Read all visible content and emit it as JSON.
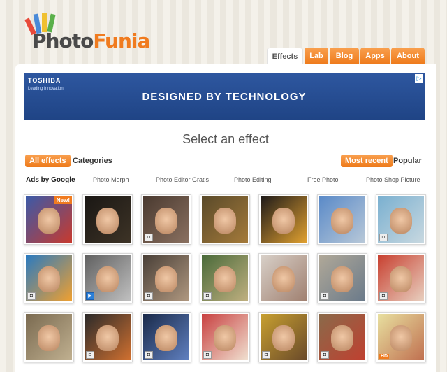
{
  "logo": {
    "part1": "Photo",
    "part2": "Funia"
  },
  "nav": {
    "tabs": [
      {
        "label": "Effects",
        "active": true
      },
      {
        "label": "Lab",
        "active": false
      },
      {
        "label": "Blog",
        "active": false
      },
      {
        "label": "Apps",
        "active": false
      },
      {
        "label": "About",
        "active": false
      }
    ]
  },
  "ad": {
    "brand": "TOSHIBA",
    "tagline": "Leading Innovation",
    "slogan": "DESIGNED BY TECHNOLOGY",
    "adchoice_icon": "adchoices-icon"
  },
  "heading": "Select an effect",
  "filters": {
    "all_effects": "All effects",
    "categories": "Categories",
    "most_recent": "Most recent",
    "popular": "Popular"
  },
  "ads_row": {
    "label": "Ads by Google",
    "links": [
      "Photo Morph",
      "Photo Editor Gratis",
      "Photo Editing",
      "Free Photo",
      "Photo Shop Picture"
    ]
  },
  "badges": {
    "new": "New!",
    "hd": "HD",
    "photo_icon": "photo-icon",
    "video_icon": "video-icon"
  },
  "colors": {
    "accent": "#ee7a1a",
    "ad_blue": "#1f4485"
  },
  "effects": [
    {
      "name": "times-square-billboard",
      "colors": [
        "#3b5aa8",
        "#c83a2e"
      ],
      "badge": "new"
    },
    {
      "name": "dark-frame",
      "colors": [
        "#1a1714",
        "#3d3326"
      ],
      "badge": ""
    },
    {
      "name": "woman-angel-wings",
      "colors": [
        "#4a3a30",
        "#8a7060"
      ],
      "badge": "photo"
    },
    {
      "name": "mona-lisa-frame",
      "colors": [
        "#5a4a2a",
        "#a47a3a"
      ],
      "badge": ""
    },
    {
      "name": "theater-marquee",
      "colors": [
        "#1e1a1a",
        "#e0a030"
      ],
      "badge": ""
    },
    {
      "name": "man-holding-portrait",
      "colors": [
        "#5a8ac8",
        "#b8c8d8"
      ],
      "badge": ""
    },
    {
      "name": "skateboarder",
      "colors": [
        "#7ab0d0",
        "#c8d8e0"
      ],
      "badge": "photo"
    },
    {
      "name": "carnival-dancer",
      "colors": [
        "#2a7ac0",
        "#f0a030"
      ],
      "badge": "photo"
    },
    {
      "name": "bw-portrait",
      "colors": [
        "#606060",
        "#c0c0c0"
      ],
      "badge": "video"
    },
    {
      "name": "vintage-desk",
      "colors": [
        "#4a4038",
        "#b09880"
      ],
      "badge": "photo"
    },
    {
      "name": "photo-in-frame-lake",
      "colors": [
        "#4a6a3a",
        "#c0b080"
      ],
      "badge": "photo"
    },
    {
      "name": "embroidery-hoop",
      "colors": [
        "#d8d0c8",
        "#a08070"
      ],
      "badge": ""
    },
    {
      "name": "street-advert-pillar",
      "colors": [
        "#b0a898",
        "#6a7a8a"
      ],
      "badge": "photo"
    },
    {
      "name": "flower-crown-girl",
      "colors": [
        "#c84030",
        "#e8d0c0"
      ],
      "badge": "photo"
    },
    {
      "name": "museum-gallery",
      "colors": [
        "#7a6a50",
        "#c0b090"
      ],
      "badge": ""
    },
    {
      "name": "basketball-player",
      "colors": [
        "#2a2a2a",
        "#d07030"
      ],
      "badge": "photo"
    },
    {
      "name": "stadium-screen",
      "colors": [
        "#1a2a4a",
        "#6080c0"
      ],
      "badge": "photo"
    },
    {
      "name": "cherries-magazine",
      "colors": [
        "#c84040",
        "#f0e0d0"
      ],
      "badge": "photo"
    },
    {
      "name": "klimt-kiss",
      "colors": [
        "#c8a030",
        "#6a4a2a"
      ],
      "badge": "photo"
    },
    {
      "name": "london-underground",
      "colors": [
        "#8a6a4a",
        "#c04030"
      ],
      "badge": "photo"
    },
    {
      "name": "glow-portrait",
      "colors": [
        "#e8e0a0",
        "#c07050"
      ],
      "badge": "hd"
    }
  ]
}
